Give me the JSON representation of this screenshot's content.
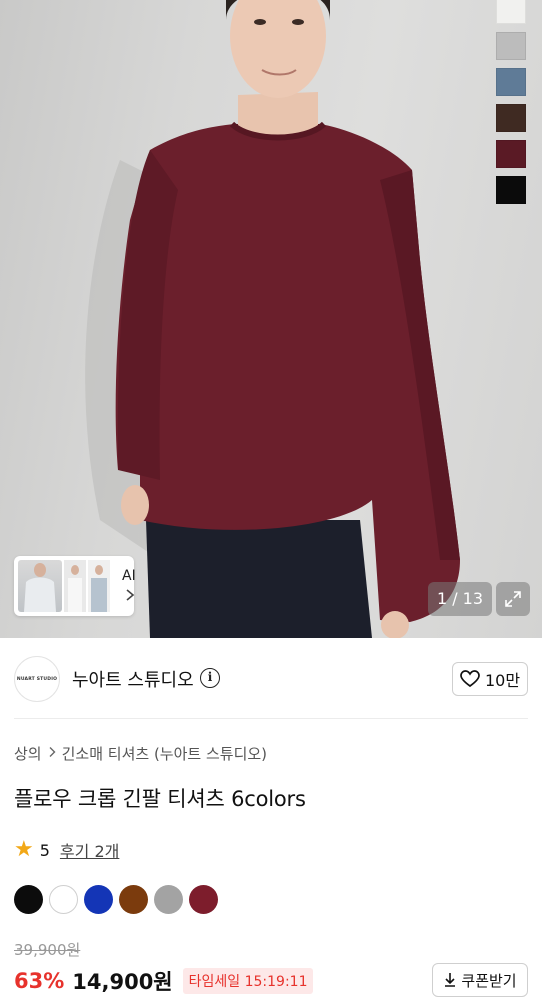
{
  "gallery": {
    "counter": "1 / 13",
    "ai_label": "AI",
    "swatch_colors": [
      "#f1f1ef",
      "#bcbcbc",
      "#5f7b97",
      "#3f2a22",
      "#5a1a25",
      "#0b0b0b"
    ],
    "icons": {
      "expand": "expand-icon",
      "chevron": "chevron-right-icon"
    }
  },
  "brand": {
    "logo_text": "NUART STUDIO",
    "name": "누아트 스튜디오",
    "info_icon_glyph": "i",
    "like_count": "10만"
  },
  "product": {
    "breadcrumb": [
      "상의",
      "긴소매 티셔츠 (누아트 스튜디오)"
    ],
    "title": "플로우 크롭 긴팔 티셔츠 6colors",
    "rating": "5",
    "review_link": "후기 2개",
    "color_options": [
      "#0c0c0c",
      "#ffffff",
      "#1435b6",
      "#7b3b0d",
      "#a3a3a3",
      "#7d1d2c"
    ],
    "original_price": "39,900원",
    "discount": "63%",
    "price": "14,900원",
    "timesale": "타임세일 15:19:11",
    "coupon_label": "쿠폰받기"
  },
  "colors": {
    "accent_red": "#e7322c",
    "shirt": "#6b1f2c"
  }
}
